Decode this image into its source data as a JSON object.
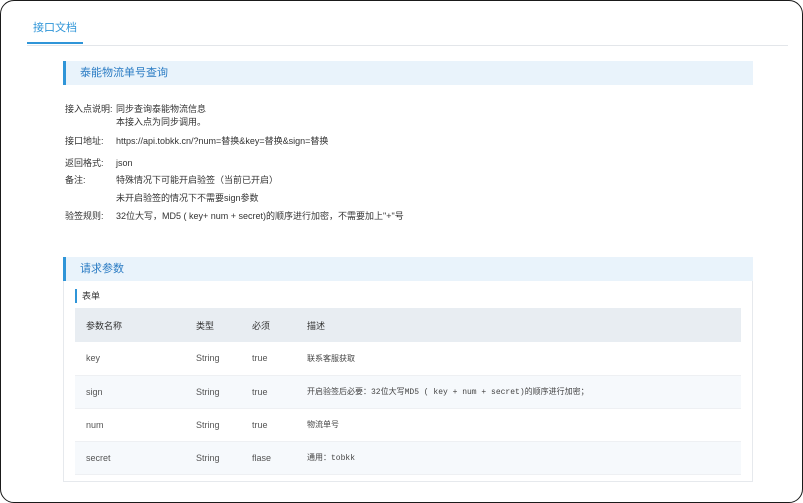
{
  "tabs": {
    "active_label": "接口文档"
  },
  "sections": {
    "tracking": {
      "title": "泰能物流单号查询"
    },
    "params": {
      "title": "请求参数",
      "subtitle": "表单"
    }
  },
  "info": {
    "entry_label": "接入点说明:",
    "entry_value_1": "同步查询泰能物流信息",
    "entry_value_2": "本接入点为同步调用。",
    "url_label": "接口地址:",
    "url_value": "https://api.tobkk.cn/?num=替换&key=替换&sign=替换",
    "format_label": "返回格式:",
    "format_value": "json",
    "note_label": "备注:",
    "note_value_1": "特殊情况下可能开启验签（当前已开启）",
    "note_value_2": "未开启验签的情况下不需要sign参数",
    "sign_label": "验签规则:",
    "sign_value": "32位大写，MD5 ( key+ num + secret)的顺序进行加密，不需要加上\"+\"号"
  },
  "table": {
    "headers": [
      "参数名称",
      "类型",
      "必须",
      "描述"
    ],
    "rows": [
      [
        "key",
        "String",
        "true",
        "联系客服获取"
      ],
      [
        "sign",
        "String",
        "true",
        "开启验签后必要：32位大写MD5 ( key + num + secret)的顺序进行加密；"
      ],
      [
        "num",
        "String",
        "true",
        "物流单号"
      ],
      [
        "secret",
        "String",
        "flase",
        "通用：tobkk"
      ]
    ]
  },
  "colors": {
    "accent": "#2f95d8",
    "section_bg": "#e9f3fb",
    "header_bg": "#e8edf2"
  }
}
